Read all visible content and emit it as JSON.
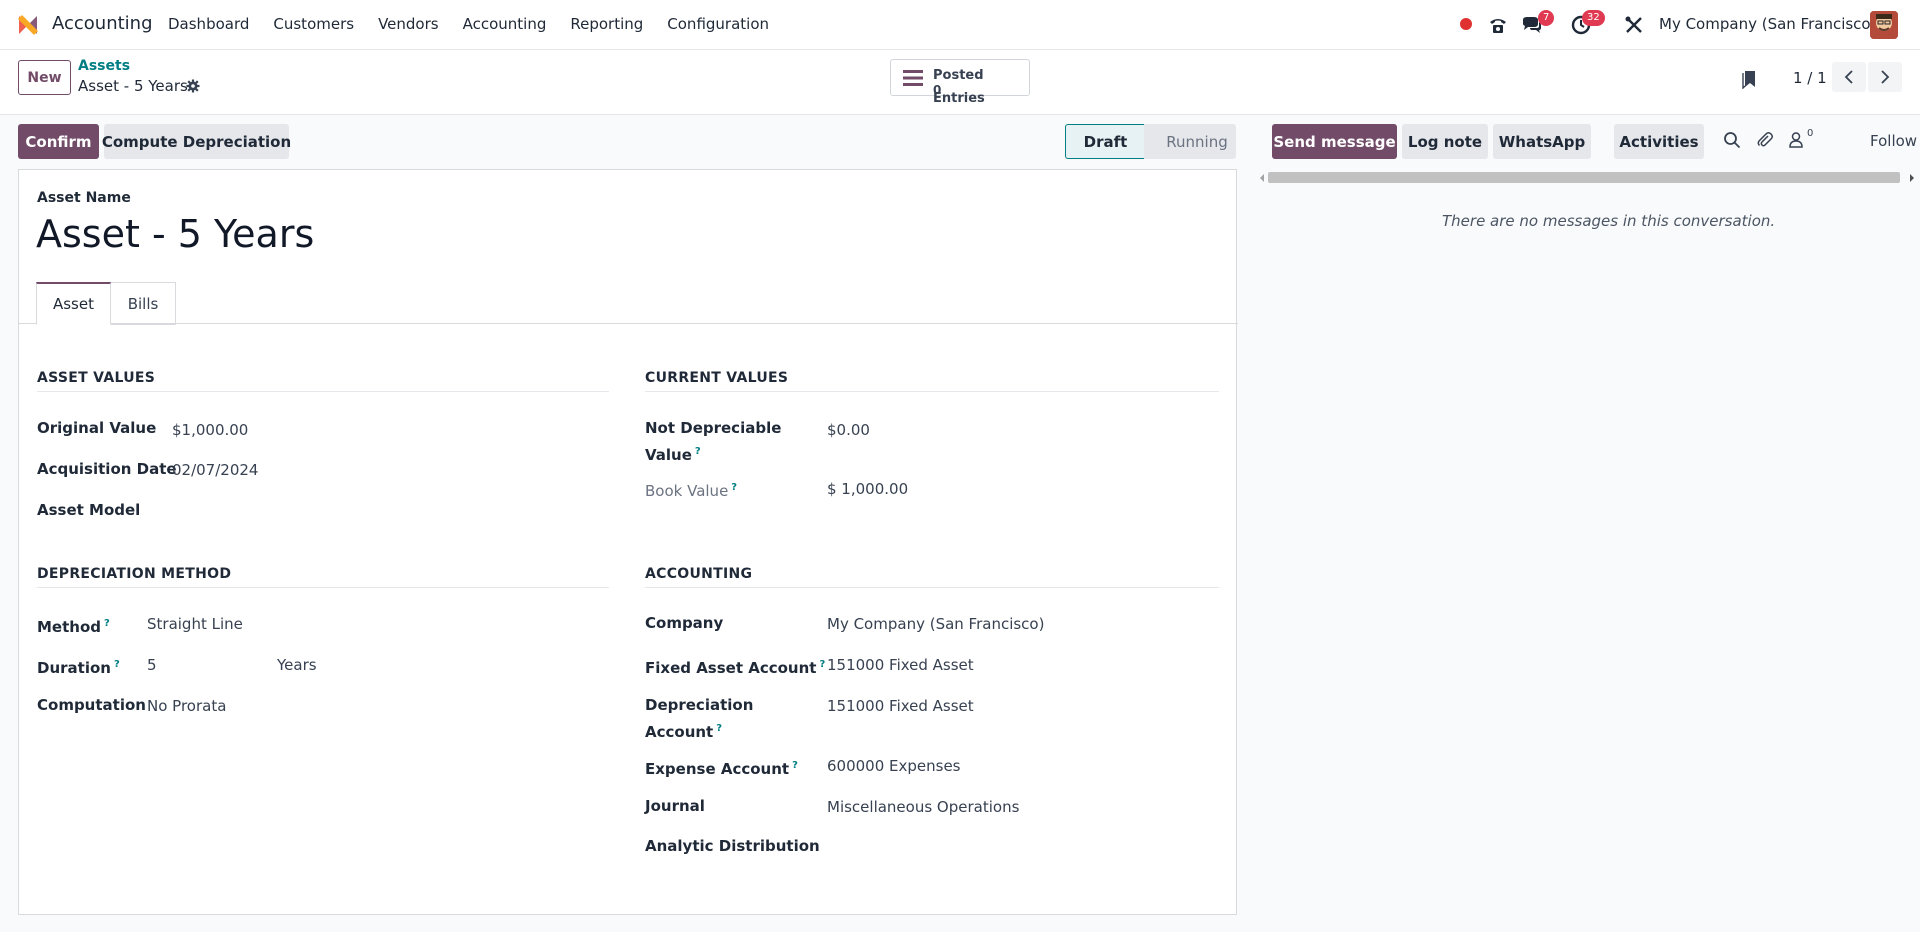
{
  "app": {
    "name": "Accounting",
    "menu": [
      "Dashboard",
      "Customers",
      "Vendors",
      "Accounting",
      "Reporting",
      "Configuration"
    ],
    "messages_badge": "7",
    "activities_badge": "32",
    "company": "My Company (San Francisco)"
  },
  "control": {
    "new_label": "New",
    "breadcrumb_parent": "Assets",
    "breadcrumb_current": "Asset - 5 Years",
    "smart_button_label": "Posted Entries",
    "smart_button_value": "0",
    "pager": "1 / 1"
  },
  "actions": {
    "confirm": "Confirm",
    "compute": "Compute Depreciation",
    "status_draft": "Draft",
    "status_running": "Running"
  },
  "form": {
    "name_label": "Asset Name",
    "name": "Asset - 5 Years",
    "tabs": [
      "Asset",
      "Bills"
    ],
    "asset_values": {
      "title": "ASSET VALUES",
      "original_value_label": "Original Value",
      "original_value": "$1,000.00",
      "acquisition_date_label": "Acquisition Date",
      "acquisition_date": "02/07/2024",
      "asset_model_label": "Asset Model"
    },
    "current_values": {
      "title": "CURRENT VALUES",
      "not_depreciable_label_1": "Not Depreciable",
      "not_depreciable_label_2": "Value",
      "not_depreciable_value": "$0.00",
      "book_value_label": "Book Value",
      "book_value": "$ 1,000.00"
    },
    "depreciation": {
      "title": "DEPRECIATION METHOD",
      "method_label": "Method",
      "method": "Straight Line",
      "duration_label": "Duration",
      "duration": "5",
      "duration_unit": "Years",
      "computation_label": "Computation",
      "computation": "No Prorata"
    },
    "accounting": {
      "title": "ACCOUNTING",
      "company_label": "Company",
      "company": "My Company (San Francisco)",
      "fixed_asset_label": "Fixed Asset Account",
      "fixed_asset": "151000 Fixed Asset",
      "depreciation_label_1": "Depreciation",
      "depreciation_label_2": "Account",
      "depreciation_account": "151000 Fixed Asset",
      "expense_label": "Expense Account",
      "expense_account": "600000 Expenses",
      "journal_label": "Journal",
      "journal": "Miscellaneous Operations",
      "analytic_label": "Analytic Distribution"
    }
  },
  "chatter": {
    "send_message": "Send message",
    "log_note": "Log note",
    "whatsapp": "WhatsApp",
    "activities": "Activities",
    "followers_count": "0",
    "follow": "Follow",
    "empty": "There are no messages in this conversation."
  },
  "colors": {
    "primary": "#714b67",
    "link": "#017e84",
    "badge": "#e03a52"
  }
}
